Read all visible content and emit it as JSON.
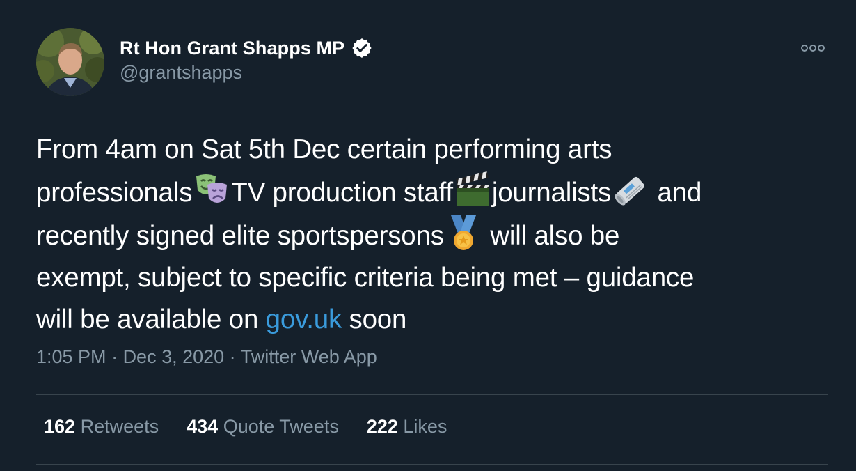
{
  "author": {
    "display_name": "Rt Hon Grant Shapps MP",
    "handle": "@grantshapps",
    "verified": true
  },
  "tweet": {
    "text_segments": {
      "line1": "From 4am on Sat 5th Dec certain performing arts",
      "line2a": "professionals",
      "line2b": "TV production staff",
      "line2c": "journalists",
      "line2d": " and",
      "line3a": "recently signed elite sportspersons",
      "line3b": " will also be",
      "line4": "exempt, subject to specific criteria being met – guidance",
      "line5a": "will be available on ",
      "link": "gov.uk",
      "line5b": " soon"
    },
    "emojis": [
      "performing-arts-icon",
      "clapper-board-icon",
      "newspaper-icon",
      "medal-icon"
    ]
  },
  "meta": {
    "time": "1:05 PM",
    "separator": " · ",
    "date": "Dec 3, 2020",
    "source": "Twitter Web App"
  },
  "stats": {
    "retweets_count": "162",
    "retweets_label": "Retweets",
    "quotes_count": "434",
    "quotes_label": "Quote Tweets",
    "likes_count": "222",
    "likes_label": "Likes"
  },
  "colors": {
    "background": "#15202b",
    "secondary_text": "#8899a6",
    "link": "#3a9bdc",
    "divider": "#38444d"
  }
}
